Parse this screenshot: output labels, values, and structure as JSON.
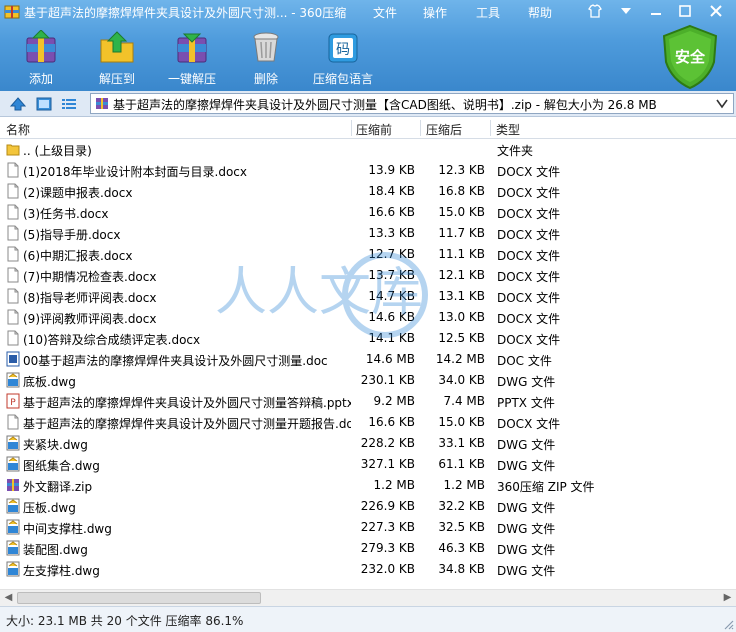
{
  "window": {
    "title": "基于超声法的摩擦焊焊件夹具设计及外圆尺寸测... - 360压缩",
    "menu": [
      "文件",
      "操作",
      "工具",
      "帮助"
    ]
  },
  "toolbar": {
    "buttons": [
      {
        "label": "添加",
        "icon": "add-archive-icon"
      },
      {
        "label": "解压到",
        "icon": "extract-to-icon"
      },
      {
        "label": "一键解压",
        "icon": "one-click-extract-icon"
      },
      {
        "label": "删除",
        "icon": "trash-icon"
      },
      {
        "label": "压缩包语言",
        "icon": "archive-language-icon",
        "badge": "码"
      }
    ],
    "security_badge": "安全"
  },
  "addressbar": {
    "path": "基于超声法的摩擦焊焊件夹具设计及外圆尺寸测量【含CAD图纸、说明书】.zip - 解包大小为 26.8 MB"
  },
  "columns": {
    "name": "名称",
    "packed": "压缩前",
    "unpacked": "压缩后",
    "type": "类型"
  },
  "files": [
    {
      "name": ".. (上级目录)",
      "before": "",
      "after": "",
      "type": "文件夹",
      "kind": "folder"
    },
    {
      "name": "(1)2018年毕业设计附本封面与目录.docx",
      "before": "13.9 KB",
      "after": "12.3 KB",
      "type": "DOCX 文件",
      "kind": "doc"
    },
    {
      "name": "(2)课题申报表.docx",
      "before": "18.4 KB",
      "after": "16.8 KB",
      "type": "DOCX 文件",
      "kind": "doc"
    },
    {
      "name": "(3)任务书.docx",
      "before": "16.6 KB",
      "after": "15.0 KB",
      "type": "DOCX 文件",
      "kind": "doc"
    },
    {
      "name": "(5)指导手册.docx",
      "before": "13.3 KB",
      "after": "11.7 KB",
      "type": "DOCX 文件",
      "kind": "doc"
    },
    {
      "name": "(6)中期汇报表.docx",
      "before": "12.7 KB",
      "after": "11.1 KB",
      "type": "DOCX 文件",
      "kind": "doc"
    },
    {
      "name": "(7)中期情况检查表.docx",
      "before": "13.7 KB",
      "after": "12.1 KB",
      "type": "DOCX 文件",
      "kind": "doc"
    },
    {
      "name": "(8)指导老师评阅表.docx",
      "before": "14.7 KB",
      "after": "13.1 KB",
      "type": "DOCX 文件",
      "kind": "doc"
    },
    {
      "name": "(9)评阅教师评阅表.docx",
      "before": "14.6 KB",
      "after": "13.0 KB",
      "type": "DOCX 文件",
      "kind": "doc"
    },
    {
      "name": "(10)答辩及综合成绩评定表.docx",
      "before": "14.1 KB",
      "after": "12.5 KB",
      "type": "DOCX 文件",
      "kind": "doc"
    },
    {
      "name": "00基于超声法的摩擦焊焊件夹具设计及外圆尺寸测量.doc",
      "before": "14.6 MB",
      "after": "14.2 MB",
      "type": "DOC 文件",
      "kind": "word"
    },
    {
      "name": "底板.dwg",
      "before": "230.1 KB",
      "after": "34.0 KB",
      "type": "DWG 文件",
      "kind": "dwg"
    },
    {
      "name": "基于超声法的摩擦焊焊件夹具设计及外圆尺寸测量答辩稿.pptx",
      "before": "9.2 MB",
      "after": "7.4 MB",
      "type": "PPTX 文件",
      "kind": "ppt"
    },
    {
      "name": "基于超声法的摩擦焊焊件夹具设计及外圆尺寸测量开题报告.docx",
      "before": "16.6 KB",
      "after": "15.0 KB",
      "type": "DOCX 文件",
      "kind": "doc"
    },
    {
      "name": "夹紧块.dwg",
      "before": "228.2 KB",
      "after": "33.1 KB",
      "type": "DWG 文件",
      "kind": "dwg"
    },
    {
      "name": "图纸集合.dwg",
      "before": "327.1 KB",
      "after": "61.1 KB",
      "type": "DWG 文件",
      "kind": "dwg"
    },
    {
      "name": "外文翻译.zip",
      "before": "1.2 MB",
      "after": "1.2 MB",
      "type": "360压缩 ZIP 文件",
      "kind": "zip"
    },
    {
      "name": "压板.dwg",
      "before": "226.9 KB",
      "after": "32.2 KB",
      "type": "DWG 文件",
      "kind": "dwg"
    },
    {
      "name": "中间支撑柱.dwg",
      "before": "227.3 KB",
      "after": "32.5 KB",
      "type": "DWG 文件",
      "kind": "dwg"
    },
    {
      "name": "装配图.dwg",
      "before": "279.3 KB",
      "after": "46.3 KB",
      "type": "DWG 文件",
      "kind": "dwg"
    },
    {
      "name": "左支撑柱.dwg",
      "before": "232.0 KB",
      "after": "34.8 KB",
      "type": "DWG 文件",
      "kind": "dwg"
    }
  ],
  "statusbar": {
    "text": "大小: 23.1 MB 共 20 个文件 压缩率 86.1%"
  },
  "watermark": {
    "text": "人人文库"
  },
  "colors": {
    "toolbar_top": "#6fb4ea",
    "toolbar_bottom": "#3a87cc",
    "security_green": "#4caf2a",
    "status_bg": "#eef3f9"
  }
}
